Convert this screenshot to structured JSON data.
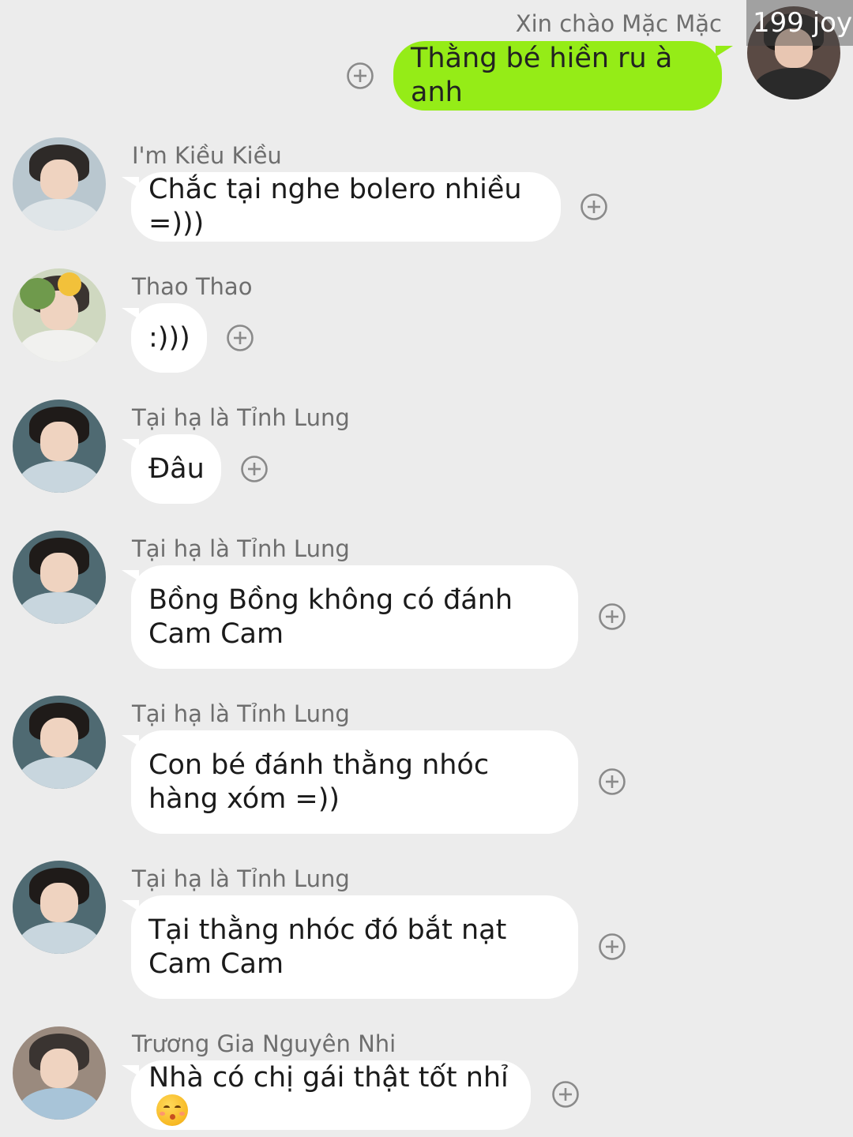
{
  "me": {
    "sender": "Xin chào Mặc Mặc",
    "badge": "199 joy",
    "message": "Thằng bé hiền ru à anh"
  },
  "messages": [
    {
      "sender": "I'm Kiều Kiều",
      "text": "Chắc tại nghe bolero nhiều =)))"
    },
    {
      "sender": "Thao Thao",
      "text": ":)))"
    },
    {
      "sender": "Tại hạ là Tỉnh Lung",
      "text": "Đâu"
    },
    {
      "sender": "Tại hạ là Tỉnh Lung",
      "text": "Bồng Bồng không có đánh Cam Cam"
    },
    {
      "sender": "Tại hạ là Tỉnh Lung",
      "text": "Con bé đánh thằng nhóc hàng xóm =))"
    },
    {
      "sender": "Tại hạ là Tỉnh Lung",
      "text": "Tại thằng nhóc đó bắt nạt Cam Cam"
    },
    {
      "sender": "Trương Gia Nguyên Nhi",
      "text": "Nhà có chị gái thật tốt nhỉ",
      "emoji": "kissing-face-emoji"
    }
  ],
  "icons": {
    "add": "plus-circle-icon"
  },
  "colors": {
    "background": "#ececec",
    "incoming_bubble": "#ffffff",
    "outgoing_bubble": "#95ec17",
    "sender_text": "#6e6e6e"
  }
}
